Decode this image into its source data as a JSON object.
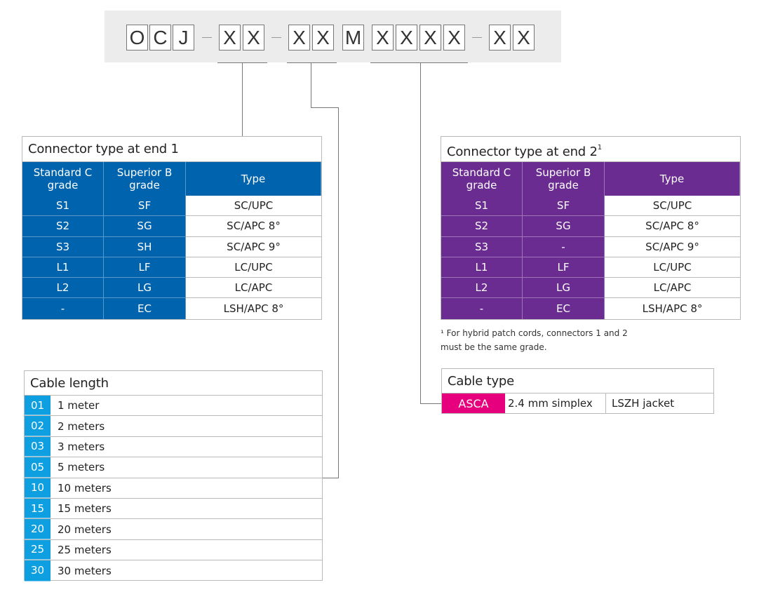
{
  "part_number": {
    "boxes": [
      "O",
      "C",
      "J",
      "X",
      "X",
      "X",
      "X",
      "M",
      "X",
      "X",
      "X",
      "X",
      "X",
      "X"
    ]
  },
  "connector_end1": {
    "title": "Connector type at end 1",
    "headers": [
      "Standard C grade",
      "Superior B grade",
      "Type"
    ],
    "rows": [
      [
        "S1",
        "SF",
        "SC/UPC"
      ],
      [
        "S2",
        "SG",
        "SC/APC 8°"
      ],
      [
        "S3",
        "SH",
        "SC/APC 9°"
      ],
      [
        "L1",
        "LF",
        "LC/UPC"
      ],
      [
        "L2",
        "LG",
        "LC/APC"
      ],
      [
        "-",
        "EC",
        "LSH/APC 8°"
      ]
    ],
    "color": "#0063ae"
  },
  "connector_end2": {
    "title": "Connector type at end 2",
    "title_sup": "1",
    "headers": [
      "Standard C grade",
      "Superior B grade",
      "Type"
    ],
    "rows": [
      [
        "S1",
        "SF",
        "SC/UPC"
      ],
      [
        "S2",
        "SG",
        "SC/APC 8°"
      ],
      [
        "S3",
        "-",
        "SC/APC 9°"
      ],
      [
        "L1",
        "LF",
        "LC/UPC"
      ],
      [
        "L2",
        "LG",
        "LC/APC"
      ],
      [
        "-",
        "EC",
        "LSH/APC 8°"
      ]
    ],
    "color": "#6b2c91"
  },
  "footnote": {
    "line1": "¹ For hybrid patch cords, connectors 1 and 2",
    "line2": "must be the same grade."
  },
  "cable_length": {
    "title": "Cable length",
    "color": "#0e9fe0",
    "rows": [
      [
        "01",
        "1 meter"
      ],
      [
        "02",
        "2 meters"
      ],
      [
        "03",
        "3 meters"
      ],
      [
        "05",
        "5 meters"
      ],
      [
        "10",
        "10 meters"
      ],
      [
        "15",
        "15 meters"
      ],
      [
        "20",
        "20 meters"
      ],
      [
        "25",
        "25 meters"
      ],
      [
        "30",
        "30 meters"
      ]
    ]
  },
  "cable_type": {
    "title": "Cable type",
    "code": "ASCA",
    "col1": "2.4 mm simplex",
    "col2": "LSZH jacket",
    "color": "#e6007e"
  }
}
